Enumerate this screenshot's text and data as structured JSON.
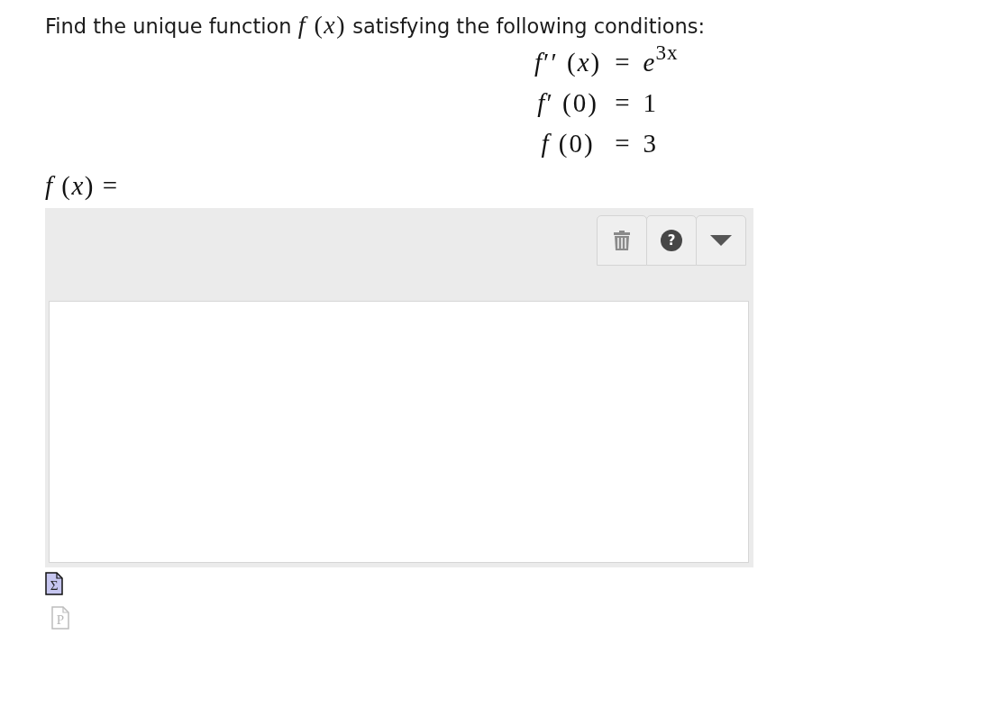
{
  "prompt": [
    {
      "kind": "text",
      "text": "Find the unique function "
    },
    {
      "kind": "math",
      "text": "*f* (*x*)"
    },
    {
      "kind": "text",
      "text": " satisfying the following conditions:"
    }
  ],
  "conditions": [
    {
      "lhs": "*f*′′ (*x*)",
      "relation": "=",
      "rhs": "*e*$^{3x}$"
    },
    {
      "lhs": "*f*′ (0)",
      "relation": "=",
      "rhs": "1"
    },
    {
      "lhs": "*f* (0)",
      "relation": "=",
      "rhs": "3"
    }
  ],
  "answer": {
    "label": "*f* (*x*) =",
    "toolbar": [
      {
        "kind": "trash"
      },
      {
        "kind": "help",
        "label": "?"
      },
      {
        "kind": "dropdown"
      }
    ]
  },
  "tools": [
    {
      "kind": "equation",
      "glyph": "Σ",
      "disabled": false
    },
    {
      "kind": "text",
      "glyph": "P",
      "disabled": true
    }
  ]
}
